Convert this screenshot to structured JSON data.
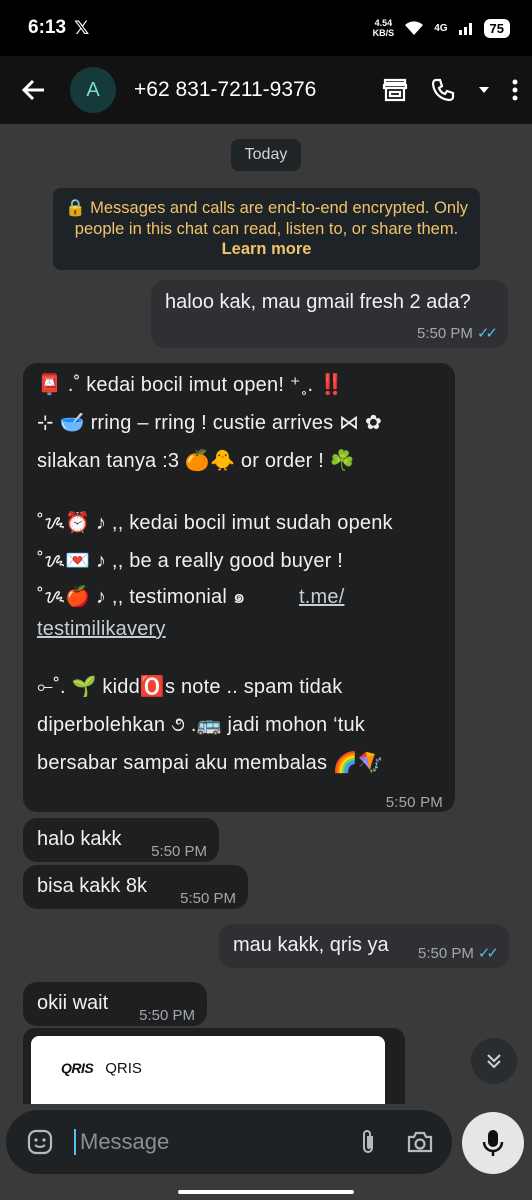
{
  "status": {
    "time": "6:13",
    "x_logo": "𝕏",
    "speed_value": "4.54",
    "speed_unit": "KB/S",
    "network": "4G",
    "battery": "75"
  },
  "header": {
    "back_icon": "arrow-left-icon",
    "avatar_letter": "A",
    "contact": "+62 831-7211-9376"
  },
  "chat": {
    "date_chip": "Today",
    "encryption_text": "🔒 Messages and calls are end-to-end encrypted. Only people in this chat can read, listen to, or share them.",
    "learn_more": "Learn more",
    "messages": [
      {
        "dir": "out",
        "text": "haloo kak, mau gmail fresh 2 ada?",
        "time": "5:50 PM"
      },
      {
        "dir": "in",
        "lines": [
          "📮 .˚ kedai bocil imut open!  ⁺˳. ‼️",
          "⊹ 🥣 rring – rring !  custie  arrives ⋈ ✿",
          "silakan  tanya :3 🍊🐥  or  order ! ☘️",
          "",
          "˚ᝰ⏰ ♪ ,, kedai bocil imut sudah openk",
          "˚ᝰ💌 ♪ ,, be  a  really  good  buyer !",
          "˚ᝰ🍎 ♪ ,, testimonial  ๑",
          "",
          "",
          "⟜˚. 🌱 kidd🅾️s note  ..  spam  tidak",
          "diperbolehkan  ૭ .🚌 jadi mohon ‘tuk",
          "bersabar sampai aku membalas 🌈🪁"
        ],
        "link_part1": "t.me/",
        "link_part2": "testimilikavery",
        "time": "5:50 PM"
      },
      {
        "dir": "in",
        "text": "halo kakk",
        "time": "5:50 PM"
      },
      {
        "dir": "in",
        "text": "bisa kakk 8k",
        "time": "5:50 PM"
      },
      {
        "dir": "out",
        "text": "mau kakk, qris ya",
        "time": "5:50 PM"
      },
      {
        "dir": "in",
        "text": "okii wait",
        "time": "5:50 PM"
      }
    ],
    "qris_logo": "QRIS",
    "qris_label": "QRIS"
  },
  "input": {
    "placeholder": "Message",
    "emoji_icon": "sticker-icon",
    "attach_icon": "paperclip-icon",
    "camera_icon": "camera-icon",
    "mic_icon": "microphone-icon"
  },
  "colors": {
    "read_ticks": "#53bdeb",
    "encryption_text": "#f0c36a",
    "out_bubble": "#2f3033",
    "in_bubble": "#1e1f21"
  }
}
